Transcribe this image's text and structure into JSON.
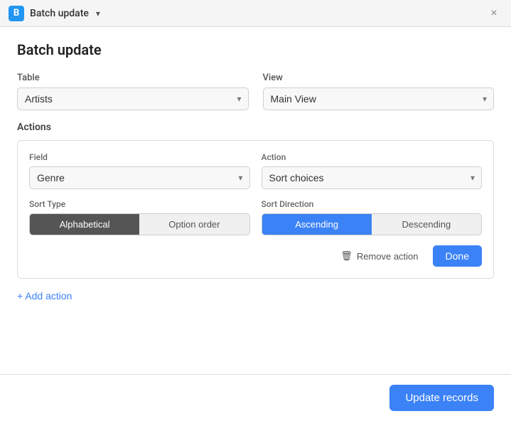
{
  "titleBar": {
    "appIconLabel": "B",
    "title": "Batch update",
    "dropdownArrow": "▾",
    "closeLabel": "×"
  },
  "modalTitle": "Batch update",
  "tableSection": {
    "label": "Table",
    "selectedValue": "Artists",
    "options": [
      "Artists"
    ]
  },
  "viewSection": {
    "label": "View",
    "selectedValue": "Main View",
    "options": [
      "Main View"
    ]
  },
  "actionsSection": {
    "label": "Actions",
    "action": {
      "fieldLabel": "Field",
      "fieldValue": "Genre",
      "fieldOptions": [
        "Genre"
      ],
      "actionLabel": "Action",
      "actionValue": "Sort choices",
      "actionOptions": [
        "Sort choices"
      ],
      "sortTypeLabel": "Sort Type",
      "sortTypeButtons": [
        {
          "label": "Alphabetical",
          "active": true
        },
        {
          "label": "Option order",
          "active": false
        }
      ],
      "sortDirectionLabel": "Sort Direction",
      "sortDirectionButtons": [
        {
          "label": "Ascending",
          "active": true
        },
        {
          "label": "Descending",
          "active": false
        }
      ],
      "removeActionLabel": "Remove action",
      "doneLabel": "Done"
    }
  },
  "addActionLabel": "+ Add action",
  "updateRecordsLabel": "Update records"
}
